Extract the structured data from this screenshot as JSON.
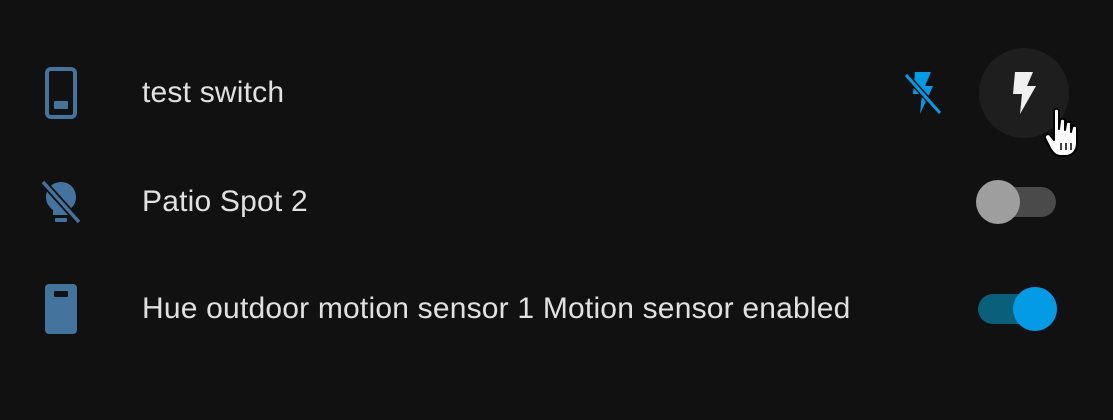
{
  "colors": {
    "background": "#111111",
    "text": "#e1e1e1",
    "entity_icon": "#44739e",
    "accent": "#039be5",
    "toggle_off_track": "#4a4a4a",
    "toggle_off_thumb": "#9e9e9e",
    "button_bg": "#1e1e1e"
  },
  "rows": [
    {
      "name": "test switch",
      "icon": "cellphone-icon",
      "controls": {
        "off_icon": "flash-off-icon",
        "on_icon": "flash-icon"
      }
    },
    {
      "name": "Patio Spot 2",
      "icon": "lightbulb-off-icon",
      "toggle_on": false
    },
    {
      "name": "Hue outdoor motion sensor 1 Motion sensor enabled",
      "icon": "remote-icon",
      "toggle_on": true
    }
  ]
}
